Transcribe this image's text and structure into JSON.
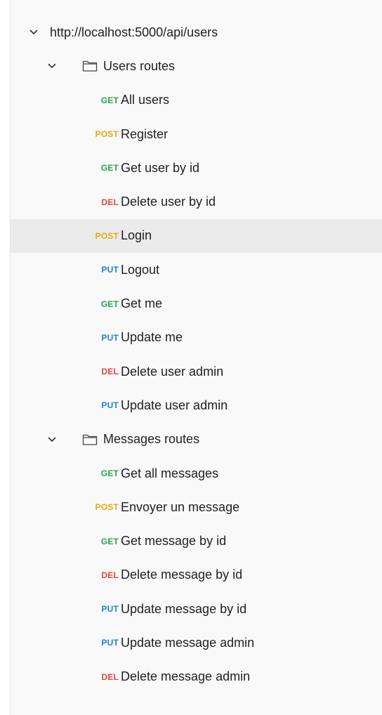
{
  "collection": {
    "root_label": "http://localhost:5000/api/users",
    "folders": [
      {
        "name": "Users routes",
        "requests": [
          {
            "method": "GET",
            "label": "All users"
          },
          {
            "method": "POST",
            "label": "Register"
          },
          {
            "method": "GET",
            "label": "Get user by id"
          },
          {
            "method": "DEL",
            "label": "Delete user by id"
          },
          {
            "method": "POST",
            "label": "Login"
          },
          {
            "method": "PUT",
            "label": "Logout"
          },
          {
            "method": "GET",
            "label": "Get me"
          },
          {
            "method": "PUT",
            "label": "Update me"
          },
          {
            "method": "DEL",
            "label": "Delete user admin"
          },
          {
            "method": "PUT",
            "label": "Update user admin"
          }
        ]
      },
      {
        "name": "Messages routes",
        "requests": [
          {
            "method": "GET",
            "label": "Get all messages"
          },
          {
            "method": "POST",
            "label": "Envoyer un message"
          },
          {
            "method": "GET",
            "label": "Get message by id"
          },
          {
            "method": "DEL",
            "label": "Delete message by id"
          },
          {
            "method": "PUT",
            "label": "Update message by id"
          },
          {
            "method": "PUT",
            "label": "Update message admin"
          },
          {
            "method": "DEL",
            "label": "Delete message admin"
          }
        ]
      }
    ]
  },
  "selected_request": "Login",
  "colors": {
    "GET": "#2ca24f",
    "POST": "#e8a915",
    "PUT": "#1f7de0",
    "DEL": "#e5453c",
    "selected_background": "#ebebeb"
  },
  "icons": {
    "expand": "chevron-down-icon",
    "folder": "folder-icon"
  }
}
